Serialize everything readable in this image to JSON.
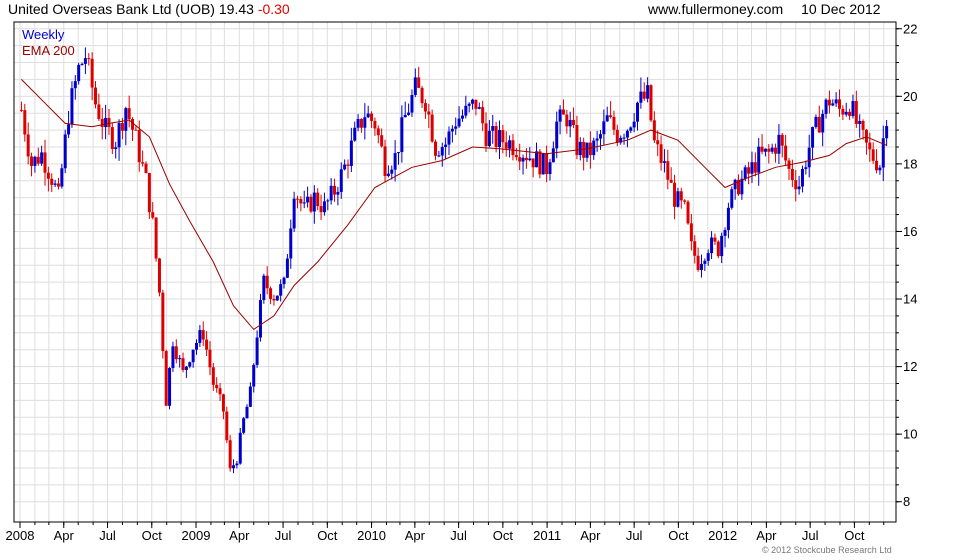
{
  "header": {
    "title": "United Overseas Bank Ltd (UOB)",
    "price": "19.43",
    "change": "-0.30",
    "source": "www.fullermoney.com",
    "date": "10 Dec 2012"
  },
  "footer": {
    "copyright": "© 2012 Stockcube Research Ltd"
  },
  "colors": {
    "up": "#0000cc",
    "down": "#dd0000",
    "ema": "#990000",
    "grid": "#dedede"
  },
  "chart_data": {
    "type": "candlestick",
    "frequency_label": "Weekly",
    "ema_label": "EMA 200",
    "x_range": [
      "2008-01-01",
      "2012-12-14"
    ],
    "ylim": [
      7.4,
      22.2
    ],
    "yticks": [
      8,
      10,
      12,
      14,
      16,
      18,
      20,
      22
    ],
    "xticks": [
      {
        "label": "2008",
        "date": "2008-01-01"
      },
      {
        "label": "Apr",
        "date": "2008-04-01"
      },
      {
        "label": "Jul",
        "date": "2008-07-01"
      },
      {
        "label": "Oct",
        "date": "2008-10-01"
      },
      {
        "label": "2009",
        "date": "2009-01-01"
      },
      {
        "label": "Apr",
        "date": "2009-04-01"
      },
      {
        "label": "Jul",
        "date": "2009-07-01"
      },
      {
        "label": "Oct",
        "date": "2009-10-01"
      },
      {
        "label": "2010",
        "date": "2010-01-01"
      },
      {
        "label": "Apr",
        "date": "2010-04-01"
      },
      {
        "label": "Jul",
        "date": "2010-07-01"
      },
      {
        "label": "Oct",
        "date": "2010-10-01"
      },
      {
        "label": "2011",
        "date": "2011-01-01"
      },
      {
        "label": "Apr",
        "date": "2011-04-01"
      },
      {
        "label": "Jul",
        "date": "2011-07-01"
      },
      {
        "label": "Oct",
        "date": "2011-10-01"
      },
      {
        "label": "2012",
        "date": "2012-01-01"
      },
      {
        "label": "Apr",
        "date": "2012-04-01"
      },
      {
        "label": "Jul",
        "date": "2012-07-01"
      },
      {
        "label": "Oct",
        "date": "2012-10-01"
      }
    ],
    "close_path": [
      [
        "2008-01-04",
        19.6
      ],
      [
        "2008-01-25",
        18.0
      ],
      [
        "2008-02-15",
        18.3
      ],
      [
        "2008-03-07",
        17.6
      ],
      [
        "2008-03-21",
        17.0
      ],
      [
        "2008-04-11",
        19.5
      ],
      [
        "2008-05-02",
        20.8
      ],
      [
        "2008-05-16",
        21.2
      ],
      [
        "2008-06-06",
        19.8
      ],
      [
        "2008-06-27",
        19.0
      ],
      [
        "2008-07-18",
        18.7
      ],
      [
        "2008-08-08",
        19.7
      ],
      [
        "2008-08-29",
        18.7
      ],
      [
        "2008-09-19",
        17.5
      ],
      [
        "2008-10-03",
        16.2
      ],
      [
        "2008-10-17",
        14.2
      ],
      [
        "2008-10-31",
        11.0
      ],
      [
        "2008-11-14",
        12.8
      ],
      [
        "2008-12-05",
        11.8
      ],
      [
        "2008-12-26",
        12.6
      ],
      [
        "2009-01-16",
        13.0
      ],
      [
        "2009-02-06",
        11.5
      ],
      [
        "2009-02-27",
        10.7
      ],
      [
        "2009-03-13",
        8.9
      ],
      [
        "2009-03-27",
        9.3
      ],
      [
        "2009-04-10",
        10.4
      ],
      [
        "2009-04-24",
        11.2
      ],
      [
        "2009-05-08",
        13.0
      ],
      [
        "2009-05-22",
        14.5
      ],
      [
        "2009-06-12",
        14.1
      ],
      [
        "2009-07-03",
        14.4
      ],
      [
        "2009-07-24",
        17.3
      ],
      [
        "2009-08-14",
        16.6
      ],
      [
        "2009-09-04",
        17.0
      ],
      [
        "2009-09-25",
        16.7
      ],
      [
        "2009-10-16",
        17.2
      ],
      [
        "2009-11-06",
        17.9
      ],
      [
        "2009-11-27",
        18.8
      ],
      [
        "2009-12-18",
        19.5
      ],
      [
        "2010-01-08",
        19.2
      ],
      [
        "2010-01-29",
        18.0
      ],
      [
        "2010-02-19",
        18.2
      ],
      [
        "2010-03-12",
        19.4
      ],
      [
        "2010-04-02",
        20.2
      ],
      [
        "2010-04-23",
        19.9
      ],
      [
        "2010-05-14",
        18.5
      ],
      [
        "2010-06-04",
        18.6
      ],
      [
        "2010-06-25",
        19.3
      ],
      [
        "2010-07-16",
        19.5
      ],
      [
        "2010-08-06",
        19.8
      ],
      [
        "2010-08-27",
        18.9
      ],
      [
        "2010-09-17",
        18.7
      ],
      [
        "2010-10-08",
        18.7
      ],
      [
        "2010-10-29",
        18.5
      ],
      [
        "2010-11-19",
        18.3
      ],
      [
        "2010-12-10",
        18.1
      ],
      [
        "2010-12-31",
        17.9
      ],
      [
        "2011-01-21",
        19.2
      ],
      [
        "2011-02-11",
        19.4
      ],
      [
        "2011-03-04",
        18.5
      ],
      [
        "2011-03-25",
        18.3
      ],
      [
        "2011-04-15",
        18.6
      ],
      [
        "2011-05-06",
        19.3
      ],
      [
        "2011-05-27",
        18.9
      ],
      [
        "2011-06-17",
        19.1
      ],
      [
        "2011-07-08",
        19.8
      ],
      [
        "2011-07-29",
        20.0
      ],
      [
        "2011-08-12",
        18.6
      ],
      [
        "2011-09-02",
        17.9
      ],
      [
        "2011-09-23",
        17.0
      ],
      [
        "2011-10-14",
        16.6
      ],
      [
        "2011-10-28",
        15.5
      ],
      [
        "2011-11-11",
        15.1
      ],
      [
        "2011-12-02",
        15.6
      ],
      [
        "2011-12-23",
        15.5
      ],
      [
        "2012-01-13",
        16.8
      ],
      [
        "2012-02-03",
        17.4
      ],
      [
        "2012-02-24",
        17.7
      ],
      [
        "2012-03-16",
        18.2
      ],
      [
        "2012-04-06",
        18.3
      ],
      [
        "2012-04-27",
        18.7
      ],
      [
        "2012-05-18",
        17.8
      ],
      [
        "2012-06-08",
        17.4
      ],
      [
        "2012-06-29",
        18.5
      ],
      [
        "2012-07-20",
        19.3
      ],
      [
        "2012-08-10",
        19.9
      ],
      [
        "2012-08-31",
        19.6
      ],
      [
        "2012-09-21",
        19.8
      ],
      [
        "2012-10-12",
        18.9
      ],
      [
        "2012-11-02",
        18.3
      ],
      [
        "2012-11-23",
        18.0
      ],
      [
        "2012-12-07",
        19.5
      ]
    ],
    "ema_200": [
      [
        "2008-01-04",
        20.5
      ],
      [
        "2008-02-15",
        19.9
      ],
      [
        "2008-04-04",
        19.2
      ],
      [
        "2008-05-30",
        19.1
      ],
      [
        "2008-07-04",
        19.2
      ],
      [
        "2008-08-15",
        19.3
      ],
      [
        "2008-09-26",
        18.8
      ],
      [
        "2008-11-07",
        17.4
      ],
      [
        "2008-12-19",
        16.3
      ],
      [
        "2009-02-06",
        15.1
      ],
      [
        "2009-03-20",
        13.8
      ],
      [
        "2009-05-01",
        13.1
      ],
      [
        "2009-06-12",
        13.5
      ],
      [
        "2009-07-24",
        14.4
      ],
      [
        "2009-09-11",
        15.1
      ],
      [
        "2009-11-13",
        16.2
      ],
      [
        "2010-01-08",
        17.3
      ],
      [
        "2010-03-26",
        17.9
      ],
      [
        "2010-05-28",
        18.1
      ],
      [
        "2010-07-30",
        18.5
      ],
      [
        "2010-09-24",
        18.45
      ],
      [
        "2010-12-31",
        18.3
      ],
      [
        "2011-03-25",
        18.45
      ],
      [
        "2011-06-17",
        18.7
      ],
      [
        "2011-08-05",
        19.0
      ],
      [
        "2011-09-30",
        18.7
      ],
      [
        "2011-11-25",
        17.9
      ],
      [
        "2012-01-06",
        17.3
      ],
      [
        "2012-02-24",
        17.6
      ],
      [
        "2012-04-20",
        17.9
      ],
      [
        "2012-06-15",
        18.05
      ],
      [
        "2012-08-10",
        18.25
      ],
      [
        "2012-09-14",
        18.6
      ],
      [
        "2012-10-26",
        18.8
      ],
      [
        "2012-12-07",
        18.55
      ]
    ]
  }
}
